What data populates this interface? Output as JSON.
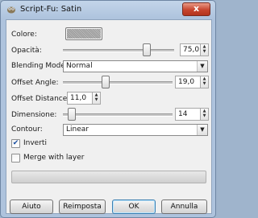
{
  "window": {
    "title": "Script-Fu: Satin",
    "close_label": "x"
  },
  "fields": {
    "colore": {
      "label": "Colore:"
    },
    "opacita": {
      "label": "Opacità:",
      "value": "75,0",
      "fraction": 0.75
    },
    "blending": {
      "label": "Blending Mode:",
      "value": "Normal"
    },
    "offset_angle": {
      "label": "Offset Angle:",
      "value": "19,0",
      "fraction": 0.39
    },
    "offset_distance": {
      "label": "Offset Distance:",
      "value": "11,0"
    },
    "dimensione": {
      "label": "Dimensione:",
      "value": "14",
      "fraction": 0.08
    },
    "contour": {
      "label": "Contour:",
      "value": "Linear"
    },
    "inverti": {
      "label": "Inverti",
      "checked": true
    },
    "merge": {
      "label": "Merge with layer",
      "checked": false
    }
  },
  "buttons": {
    "aiuto": "Aiuto",
    "reimposta": "Reimposta",
    "ok": "OK",
    "annulla": "Annulla"
  },
  "icons": {
    "app": "gimp-icon",
    "checkmark": "✔",
    "combo_arrow": "▼",
    "spin_up": "▲",
    "spin_down": "▼"
  }
}
